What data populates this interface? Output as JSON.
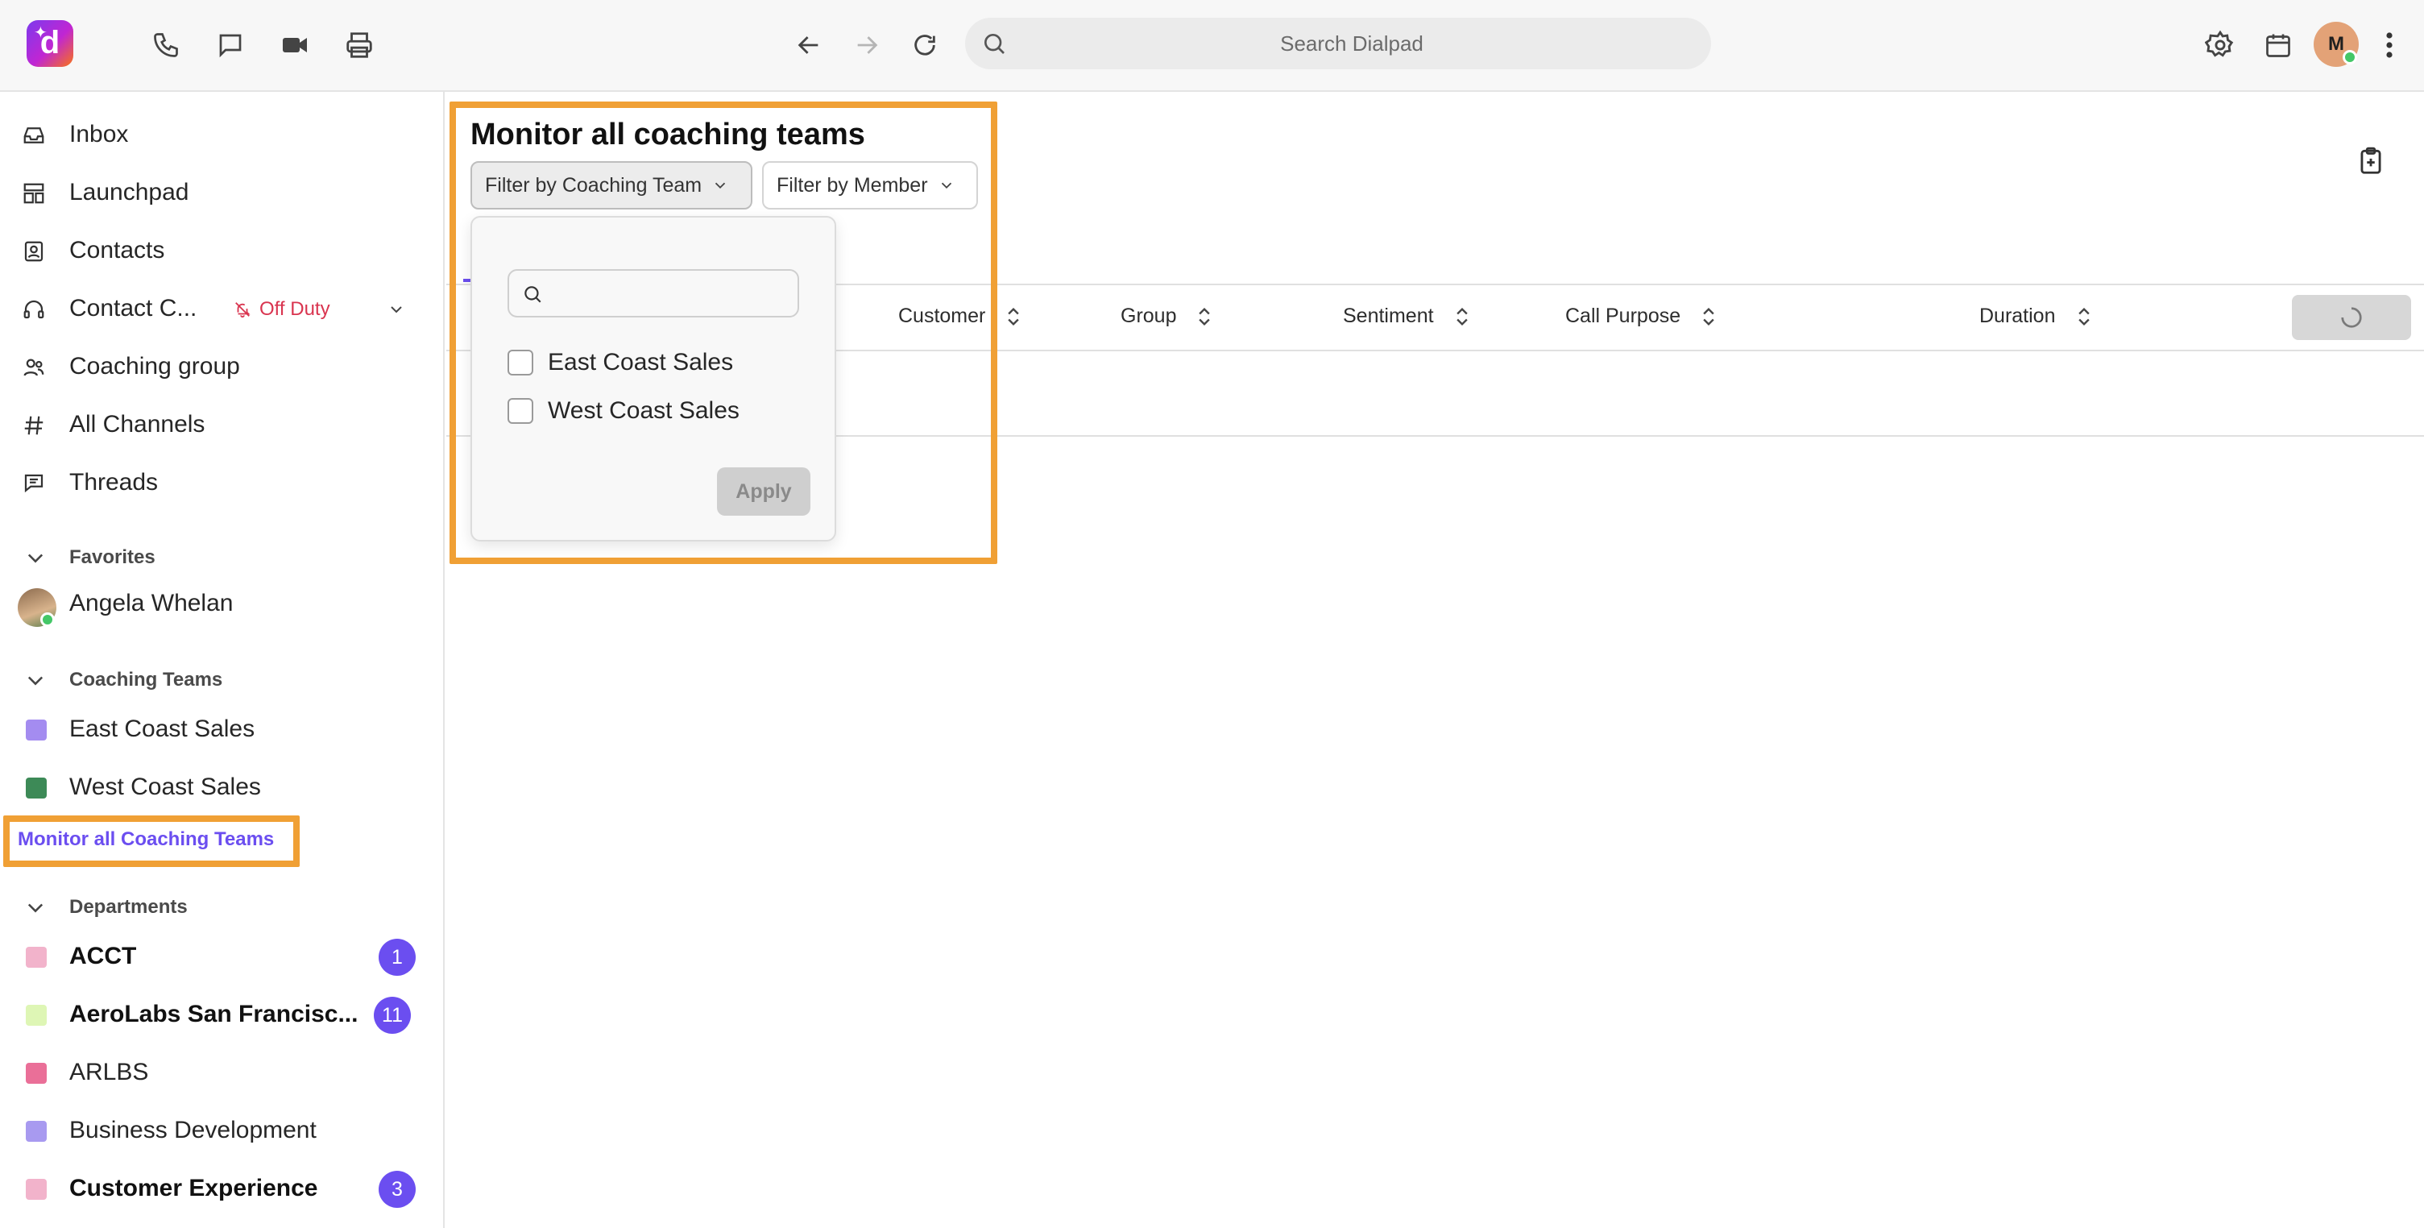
{
  "topbar": {
    "logo_letter": "d",
    "icons": [
      "phone-icon",
      "chat-icon",
      "video-icon",
      "print-icon",
      "back-icon",
      "forward-icon",
      "refresh-icon",
      "settings-icon",
      "calendar-icon",
      "more-icon"
    ],
    "search_placeholder": "Search Dialpad",
    "avatar_initial": "M"
  },
  "sidebar": {
    "nav": [
      {
        "label": "Inbox",
        "icon": "inbox-icon"
      },
      {
        "label": "Launchpad",
        "icon": "launchpad-icon"
      },
      {
        "label": "Contacts",
        "icon": "contacts-icon"
      },
      {
        "label": "Contact C...",
        "icon": "headset-icon",
        "status": "Off Duty"
      },
      {
        "label": "Coaching group",
        "icon": "people-icon"
      },
      {
        "label": "All Channels",
        "icon": "hash-icon"
      },
      {
        "label": "Threads",
        "icon": "threads-icon"
      }
    ],
    "favorites": {
      "title": "Favorites",
      "items": [
        {
          "label": "Angela Whelan"
        }
      ]
    },
    "coaching_teams": {
      "title": "Coaching Teams",
      "items": [
        {
          "label": "East Coast Sales",
          "color": "#a48cf0"
        },
        {
          "label": "West Coast Sales",
          "color": "#3d8a57"
        }
      ],
      "monitor_link": "Monitor all Coaching Teams"
    },
    "departments": {
      "title": "Departments",
      "items": [
        {
          "label": "ACCT",
          "color": "#f2b3cb",
          "badge": "1",
          "bold": true
        },
        {
          "label": "AeroLabs San Francisc...",
          "color": "#def6b5",
          "badge": "11",
          "bold": true
        },
        {
          "label": "ARLBS",
          "color": "#ea6f98",
          "badge": "",
          "bold": false
        },
        {
          "label": "Business Development",
          "color": "#a89af0",
          "badge": "",
          "bold": false
        },
        {
          "label": "Customer Experience",
          "color": "#f2b3cb",
          "badge": "3",
          "bold": true
        }
      ]
    }
  },
  "main": {
    "title": "Monitor all coaching teams",
    "filters": {
      "coaching_team": "Filter by Coaching Team",
      "member": "Filter by Member"
    },
    "columns": [
      "Customer",
      "Group",
      "Sentiment",
      "Call Purpose",
      "Duration"
    ],
    "dropdown": {
      "search_placeholder": "",
      "options": [
        "East Coast Sales",
        "West Coast Sales"
      ],
      "apply": "Apply"
    }
  },
  "colors": {
    "accent": "#6b4ef0",
    "highlight": "#f0a035",
    "off_duty": "#d9344f"
  }
}
